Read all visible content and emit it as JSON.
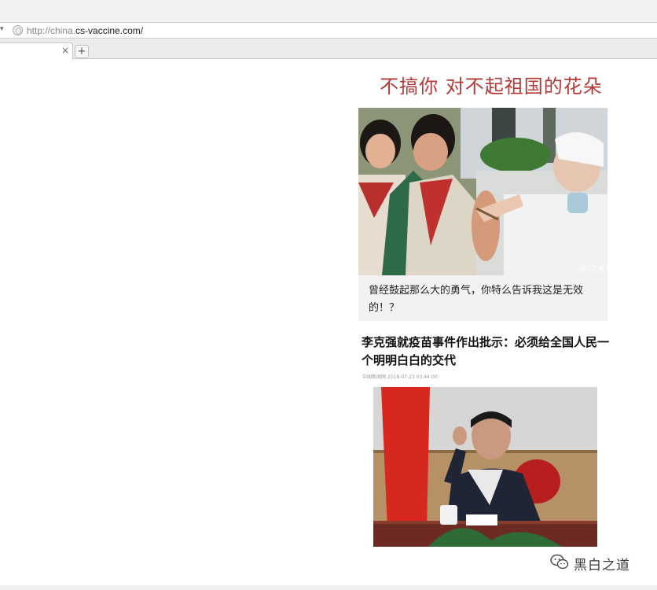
{
  "browser": {
    "url_scheme": "http://china.",
    "url_host": "cs-vaccine.com/",
    "tab_close": "×",
    "new_tab": "+"
  },
  "page": {
    "headline": "不搞你  对不起祖国的花朵",
    "photo1_credit": "@江之客",
    "photo1_caption": "曾经鼓起那么大的勇气，你特么告诉我这是无效的！？",
    "news_title": "李克强就疫苗事件作出批示：必须给全国人民一个明明白白的交代",
    "news_meta": "中国新闻网 2018-07-23 03:44:00"
  },
  "watermark": {
    "text": "黑白之道",
    "icon": "wechat-icon"
  },
  "colors": {
    "headline": "#b23a36",
    "caption_bg": "#f2f2f2"
  }
}
